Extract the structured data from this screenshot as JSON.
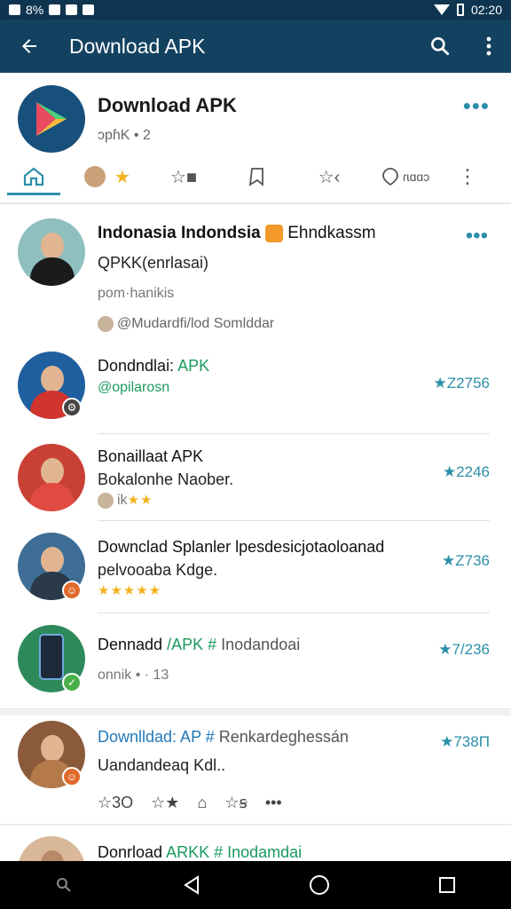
{
  "status_bar": {
    "left_text": "8%",
    "time": "02:20"
  },
  "app_bar": {
    "title": "Download APK",
    "back_icon": "arrow-left-icon",
    "search_icon": "search-icon",
    "more_icon": "more-vert-icon"
  },
  "app_header": {
    "title": "Download APK",
    "subtitle": "ɔpɦK • 2",
    "more": "•••",
    "tabs": [
      {
        "icon": "home-icon",
        "label": ""
      },
      {
        "icon": "avatar-star",
        "label": "★"
      },
      {
        "icon": "star-outline-icon",
        "label": "☆■"
      },
      {
        "icon": "bookmark-icon",
        "label": ""
      },
      {
        "icon": "star-outline-icon",
        "label": "☆‹"
      },
      {
        "icon": "pin-icon",
        "label": "ɾɩɑɑɔ"
      },
      {
        "icon": "more-vert-icon",
        "label": "⋮"
      }
    ]
  },
  "posts": [
    {
      "title_bold": "Indonasia Indondsia",
      "title_rest": "Ehndkassm",
      "line2": "QPKK(enrlasai)",
      "meta": "pom·hanikis",
      "footer": "@Mudardfi/lod Somlddar",
      "more": "•••",
      "avatar_color": "#8fbfbf",
      "badge": ""
    },
    {
      "title_plain": "Dondndlai:",
      "title_green": "APK",
      "line2": "@opilarosn",
      "rating": "★Z2756",
      "avatar_color": "#1f5fa0",
      "badge": "⚙"
    },
    {
      "title_plain": "Bonaillaat APK",
      "line2": "Bokalonhe Naober.",
      "meta_prefix": "ik",
      "meta_stars": "★★",
      "rating": "★2246",
      "avatar_color": "#c94035",
      "badge": ""
    },
    {
      "title_plain": "Downclad Splanler lpesdesicjotaoloanad",
      "line2": "pelvooaba Kdge.",
      "meta_stars": "★★★★★",
      "rating": "★Z736",
      "avatar_color": "#3e6e96",
      "badge": "☺"
    },
    {
      "title_plain": "Dennadd",
      "title_green": "/APK #",
      "title_rest": "Inodandoai",
      "line2": "onnik • · 13",
      "rating": "★7/236",
      "avatar_color": "#2e8a5a",
      "badge": "✓"
    },
    {
      "title_blue": "Downlldad: AP #",
      "title_rest": "Renkardeghessán",
      "line2": "Uandandeaq Kdl..",
      "rating": "★738Π",
      "avatar_color": "#8a5a3a",
      "badge": "☺",
      "actions": [
        "☆3Ο",
        "☆★",
        "⌂",
        "☆ꞩ",
        "•••"
      ]
    },
    {
      "title_plain": "Donrload",
      "title_green": "ARKK #",
      "title_rest": "Inodamdai",
      "avatar_color": "#d8b898"
    }
  ],
  "nav_bar": {
    "icons": [
      "search-icon",
      "back-triangle-icon",
      "home-circle-icon",
      "recents-square-icon"
    ]
  }
}
